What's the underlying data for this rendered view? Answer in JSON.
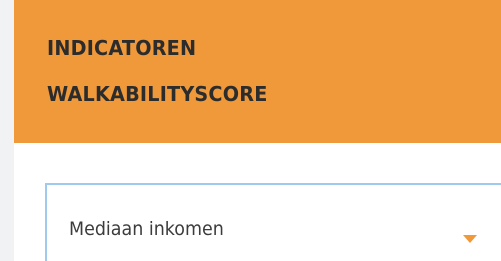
{
  "panel": {
    "title_line_1": "INDICATOREN",
    "title_line_2": "WALKABILITYSCORE"
  },
  "indicator_select": {
    "selected_value": "Mediaan inkomen",
    "caret_icon": "chevron-down-icon"
  },
  "colors": {
    "header_accent": "#f0993a",
    "select_border": "#9ecaf0",
    "page_background": "#f1f2f3"
  }
}
